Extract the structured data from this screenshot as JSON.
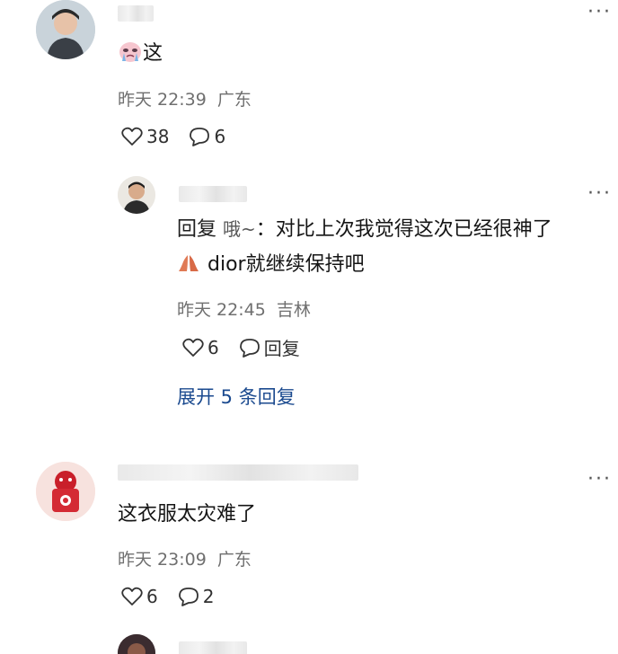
{
  "comments": [
    {
      "text": "这",
      "time": "昨天 22:39",
      "location": "广东",
      "likes": "38",
      "replies": "6",
      "emoji_icon": "crying-face-icon"
    },
    {
      "reply_prefix": "回复",
      "reply_to": "哦~",
      "reply_sep": "：",
      "text_line1": "对比上次我觉得这次已经很神了",
      "text_line2": "dior就继续保持吧",
      "emoji_icon": "praying-hands-icon",
      "time": "昨天 22:45",
      "location": "吉林",
      "likes": "6",
      "reply_label": "回复"
    },
    {
      "text": "这衣服太灾难了",
      "time": "昨天 23:09",
      "location": "广东",
      "likes": "6",
      "replies": "2"
    }
  ],
  "expand_replies": "展开 5 条回复",
  "colors": {
    "link": "#1b4a8f",
    "meta": "#6f6f6f"
  }
}
